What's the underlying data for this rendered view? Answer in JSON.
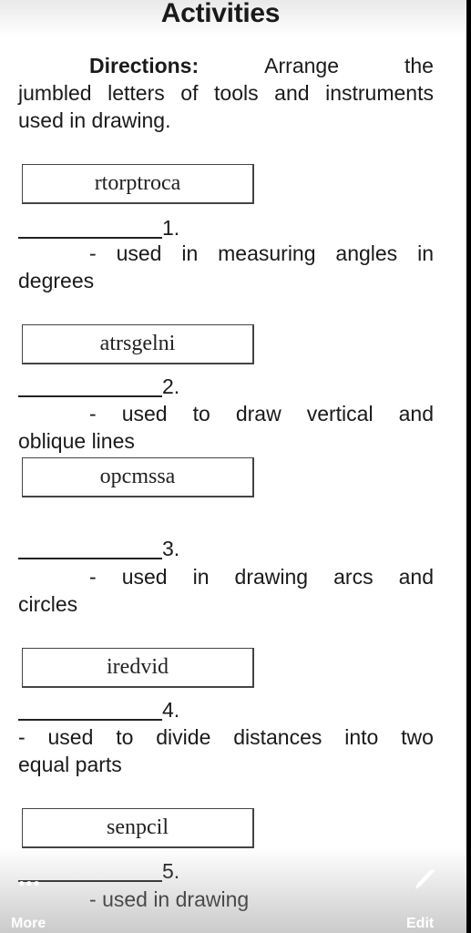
{
  "title": "Activities",
  "directions": {
    "label": "Directions:",
    "line1_words": [
      "Arrange",
      "the"
    ],
    "rest": "jumbled letters of tools and instruments used in drawing."
  },
  "items": [
    {
      "jumbled": "rtorptroca",
      "number": "1.",
      "desc_line1": [
        "-",
        "used",
        "in",
        "measuring",
        "angles",
        "in"
      ],
      "desc_line2": "degrees"
    },
    {
      "jumbled": "atrsgelni",
      "number": "2.",
      "desc_line1": [
        "-",
        "used",
        "to",
        "draw",
        "vertical",
        "and"
      ],
      "desc_line2": "oblique lines"
    },
    {
      "jumbled": "opcmssa",
      "number": "3.",
      "desc_line1": [
        "-",
        "used",
        "in",
        "drawing",
        "arcs",
        "and"
      ],
      "desc_line2": "circles"
    },
    {
      "jumbled": "iredvid",
      "number": "4.",
      "desc_line1": [
        "-",
        "used",
        "to",
        "divide",
        "distances",
        "into",
        "two"
      ],
      "desc_line2": "equal parts"
    },
    {
      "jumbled": "senpcil",
      "number": "5.",
      "desc_line1": [
        "-",
        "used in drawing"
      ],
      "desc_line2": ""
    }
  ],
  "toolbar": {
    "more_icon": "ellipsis-icon",
    "more_label": "More",
    "edit_icon": "pencil-icon",
    "edit_label": "Edit"
  }
}
